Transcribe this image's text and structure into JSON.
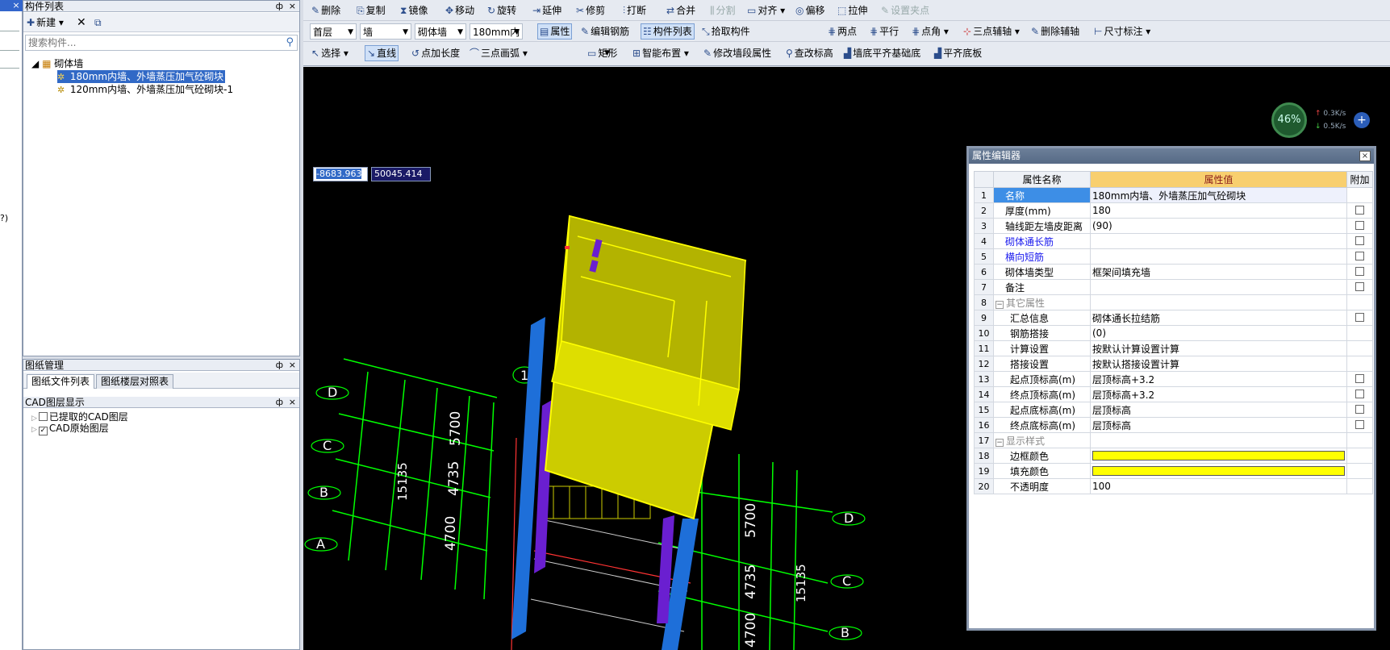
{
  "left_strip": {
    "close": "×",
    "paren": "?)"
  },
  "component_list": {
    "title": "构件列表",
    "pin": "ф",
    "close": "×",
    "new_label": "新建",
    "search_placeholder": "搜索构件...",
    "tree": {
      "root": "砌体墙",
      "items": [
        "180mm内墙、外墙蒸压加气砼砌块",
        "120mm内墙、外墙蒸压加气砼砌块-1"
      ]
    }
  },
  "drawing_management": {
    "title": "图纸管理",
    "tabs": [
      "图纸文件列表",
      "图纸楼层对照表"
    ],
    "layer_title": "CAD图层显示",
    "layers": [
      {
        "label": "已提取的CAD图层",
        "checked": false
      },
      {
        "label": "CAD原始图层",
        "checked": true
      }
    ]
  },
  "toolbar1": [
    "删除",
    "复制",
    "镜像",
    "移动",
    "旋转",
    "延伸",
    "修剪",
    "打断",
    "合并",
    "分割",
    "对齐",
    "偏移",
    "拉伸",
    "设置夹点"
  ],
  "toolbar2": {
    "floor": "首层",
    "type": "墙",
    "subtype": "砌体墙",
    "component": "180mm内",
    "tools": [
      "属性",
      "编辑钢筋",
      "构件列表",
      "拾取构件",
      "两点",
      "平行",
      "点角",
      "三点辅轴",
      "删除辅轴",
      "尺寸标注"
    ]
  },
  "toolbar3": [
    "选择",
    "直线",
    "点加长度",
    "三点画弧",
    "矩形",
    "智能布置",
    "修改墙段属性",
    "查改标高",
    "墙底平齐基础底",
    "平齐底板"
  ],
  "canvas": {
    "coord_x": "-8683.963",
    "coord_y": "50045.414",
    "gauge_percent": "46%",
    "gauge_up": "0.3K/s",
    "gauge_down": "0.5K/s",
    "gauge_plus": "+",
    "axis_labels_left": [
      "D",
      "C",
      "B",
      "A"
    ],
    "axis_labels_right": [
      "D",
      "C",
      "B"
    ],
    "dims_left": [
      "5700",
      "4735",
      "4700",
      "15135"
    ],
    "dims_right": [
      "5700",
      "4735",
      "4700",
      "15135"
    ],
    "column_label": "1",
    "colors": {
      "wall_fill": "#cccc00",
      "wall_edge": "#ffff00",
      "grid": "#00ff00",
      "column_blue": "#1e6fd9",
      "column_purple": "#6a1fd0"
    }
  },
  "property_editor": {
    "title": "属性编辑器",
    "close": "×",
    "headers": {
      "name": "属性名称",
      "value": "属性值",
      "add": "附加"
    },
    "rows": [
      {
        "n": "1",
        "name": "名称",
        "value": "180mm内墙、外墙蒸压加气砼砌块",
        "style": "sel",
        "check": false
      },
      {
        "n": "2",
        "name": "厚度(mm)",
        "value": "180",
        "style": "",
        "check": true
      },
      {
        "n": "3",
        "name": "轴线距左墙皮距离",
        "value": "(90)",
        "style": "",
        "check": true
      },
      {
        "n": "4",
        "name": "砌体通长筋",
        "value": "",
        "style": "blue",
        "check": true
      },
      {
        "n": "5",
        "name": "横向短筋",
        "value": "",
        "style": "blue",
        "check": true
      },
      {
        "n": "6",
        "name": "砌体墙类型",
        "value": "框架间填充墙",
        "style": "",
        "check": true
      },
      {
        "n": "7",
        "name": "备注",
        "value": "",
        "style": "",
        "check": true
      },
      {
        "n": "8",
        "name": "其它属性",
        "value": "",
        "style": "grp",
        "check": false
      },
      {
        "n": "9",
        "name": "汇总信息",
        "value": "砌体通长拉结筋",
        "style": "sub",
        "check": true
      },
      {
        "n": "10",
        "name": "钢筋搭接",
        "value": "(0)",
        "style": "sub",
        "check": false
      },
      {
        "n": "11",
        "name": "计算设置",
        "value": "按默认计算设置计算",
        "style": "sub",
        "check": false
      },
      {
        "n": "12",
        "name": "搭接设置",
        "value": "按默认搭接设置计算",
        "style": "sub",
        "check": false
      },
      {
        "n": "13",
        "name": "起点顶标高(m)",
        "value": "层顶标高+3.2",
        "style": "sub",
        "check": true
      },
      {
        "n": "14",
        "name": "终点顶标高(m)",
        "value": "层顶标高+3.2",
        "style": "sub",
        "check": true
      },
      {
        "n": "15",
        "name": "起点底标高(m)",
        "value": "层顶标高",
        "style": "sub",
        "check": true
      },
      {
        "n": "16",
        "name": "终点底标高(m)",
        "value": "层顶标高",
        "style": "sub",
        "check": true
      },
      {
        "n": "17",
        "name": "显示样式",
        "value": "",
        "style": "grp",
        "check": false
      },
      {
        "n": "18",
        "name": "边框颜色",
        "value": "",
        "style": "sub",
        "check": false,
        "swatch": "#ffff00"
      },
      {
        "n": "19",
        "name": "填充颜色",
        "value": "",
        "style": "sub",
        "check": false,
        "swatch": "#ffff00"
      },
      {
        "n": "20",
        "name": "不透明度",
        "value": "100",
        "style": "sub",
        "check": false
      }
    ]
  }
}
